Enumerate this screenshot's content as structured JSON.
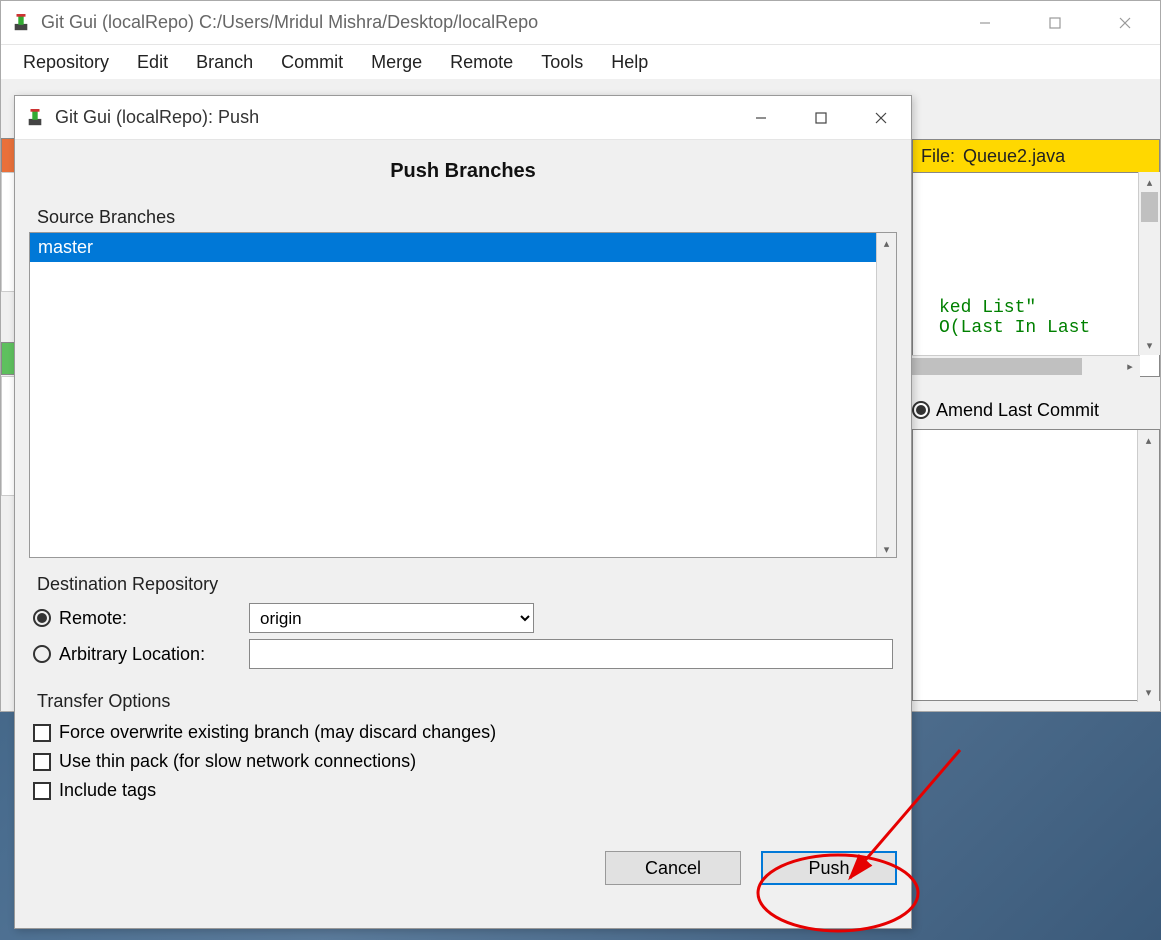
{
  "main_window": {
    "title": "Git Gui (localRepo) C:/Users/Mridul Mishra/Desktop/localRepo",
    "menubar": [
      "Repository",
      "Edit",
      "Branch",
      "Commit",
      "Merge",
      "Remote",
      "Tools",
      "Help"
    ],
    "file_header_label": "File:",
    "file_header_name": "Queue2.java",
    "file_content_line1": "ked List\"",
    "file_content_line2": "O(Last In Last",
    "amend_label": "Amend Last Commit"
  },
  "push_dialog": {
    "title": "Git Gui (localRepo): Push",
    "header": "Push Branches",
    "source_branches_label": "Source Branches",
    "branches": [
      "master"
    ],
    "destination_repo_label": "Destination Repository",
    "remote_label": "Remote:",
    "remote_value": "origin",
    "arbitrary_label": "Arbitrary Location:",
    "arbitrary_value": "",
    "transfer_options_label": "Transfer Options",
    "opt_force": "Force overwrite existing branch (may discard changes)",
    "opt_thin": "Use thin pack (for slow network connections)",
    "opt_tags": "Include tags",
    "cancel_label": "Cancel",
    "push_label": "Push"
  }
}
